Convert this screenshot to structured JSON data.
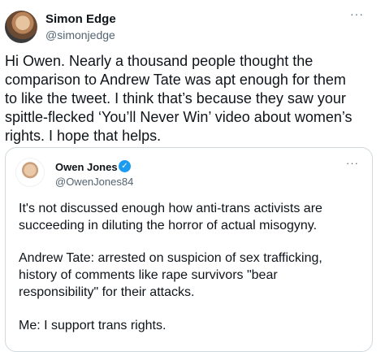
{
  "tweet": {
    "author_name": "Simon Edge",
    "author_handle": "@simonjedge",
    "more_glyph": "···",
    "avatar_icon": "user-avatar-photo",
    "text_lines": [
      "Hi Owen. Nearly a thousand people thought the",
      "comparison to Andrew Tate was apt enough for them",
      "to like the tweet. I think that’s because they saw your",
      "spittle-flecked ‘You’ll Never Win’ video about women’s",
      "rights. I hope that helps."
    ]
  },
  "quoted": {
    "author_name": "Owen Jones",
    "author_handle": "@OwenJones84",
    "more_glyph": "···",
    "verified_icon": "verified-badge-icon",
    "verified_glyph": "✓",
    "verified_color": "#1d9bf0",
    "paragraph1": [
      "It's not discussed enough how anti-trans activists are",
      "succeeding in diluting the horror of actual misogyny."
    ],
    "paragraph2": [
      "Andrew Tate: arrested on suspicion of sex trafficking,",
      "history of comments like rape survivors \"bear",
      "responsibility\" for their attacks."
    ],
    "paragraph3": [
      "Me: I support trans rights."
    ]
  }
}
